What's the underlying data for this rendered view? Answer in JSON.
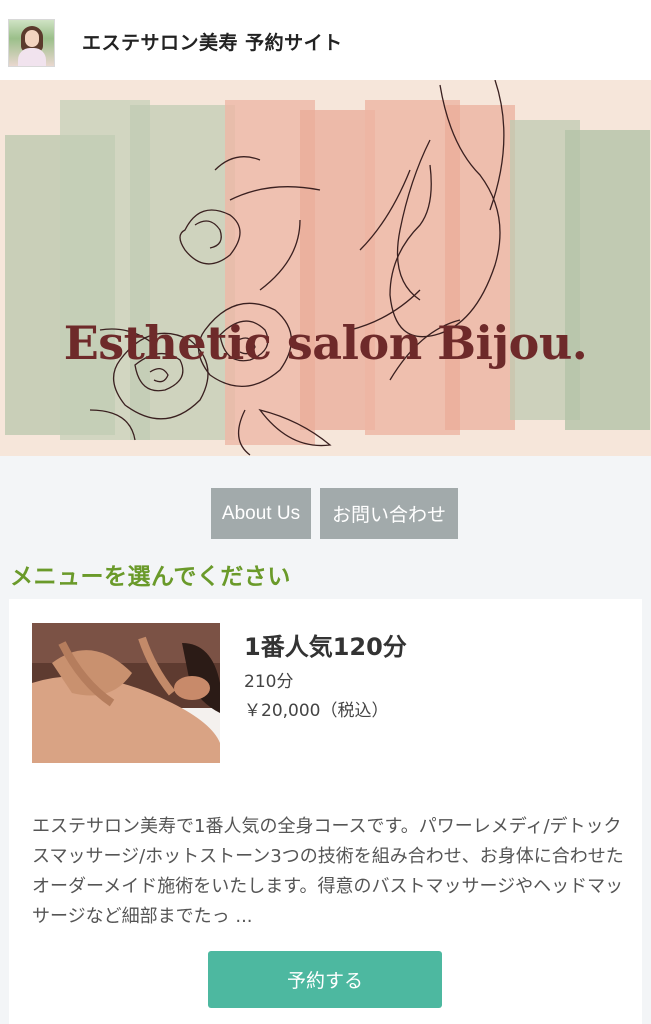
{
  "header": {
    "title": "エステサロン美寿 予約サイト",
    "avatar_icon": "avatar-icon"
  },
  "banner": {
    "title": "Esthetic salon Bijou."
  },
  "nav": {
    "about_label": "About Us",
    "contact_label": "お問い合わせ"
  },
  "section": {
    "heading": "メニューを選んでください"
  },
  "menu": {
    "items": [
      {
        "name": "1番人気120分",
        "duration": "210分",
        "price": "￥20,000（税込）",
        "description": "エステサロン美寿で1番人気の全身コースです。パワーレメディ/デトックスマッサージ/ホットストーン3つの技術を組み合わせ、お身体に合わせたオーダーメイド施術をいたします。得意のバストマッサージやヘッドマッサージなど細部までたっ ...",
        "reserve_label": "予約する"
      }
    ]
  },
  "colors": {
    "heading_green": "#6a9a2a",
    "button_teal": "#4db8a0",
    "nav_gray": "#a2aaab",
    "banner_text": "#6e2a2a"
  }
}
